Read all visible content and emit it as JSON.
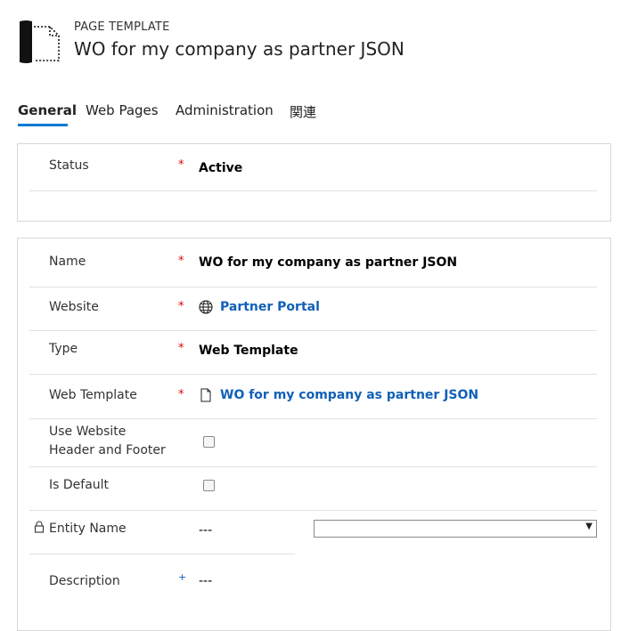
{
  "header": {
    "entity_type": "PAGE TEMPLATE",
    "title": "WO for my company as partner JSON",
    "icon": "page-template-icon"
  },
  "tabs": [
    {
      "label": "General",
      "active": true
    },
    {
      "label": "Web Pages",
      "active": false
    },
    {
      "label": "Administration",
      "active": false
    },
    {
      "label": "関連",
      "active": false
    }
  ],
  "status_section": {
    "status_label": "Status",
    "status_required": "*",
    "status_value": "Active"
  },
  "general_section": {
    "name": {
      "label": "Name",
      "required": "*",
      "value": "WO for my company as partner JSON"
    },
    "website": {
      "label": "Website",
      "required": "*",
      "value": "Partner Portal",
      "icon": "globe-icon"
    },
    "type": {
      "label": "Type",
      "required": "*",
      "value": "Web Template"
    },
    "web_template": {
      "label": "Web Template",
      "required": "*",
      "value": "WO for my company as partner JSON",
      "icon": "document-icon"
    },
    "use_header_footer": {
      "label": "Use Website Header and Footer",
      "checked": false
    },
    "is_default": {
      "label": "Is Default",
      "checked": false
    },
    "entity_name": {
      "label": "Entity Name",
      "value": "---",
      "locked": true,
      "icon": "lock-icon",
      "dropdown_value": ""
    },
    "description": {
      "label": "Description",
      "required": "+",
      "value": "---"
    }
  },
  "colors": {
    "accent": "#0078d4",
    "link": "#1160b7",
    "required": "#e00000"
  }
}
